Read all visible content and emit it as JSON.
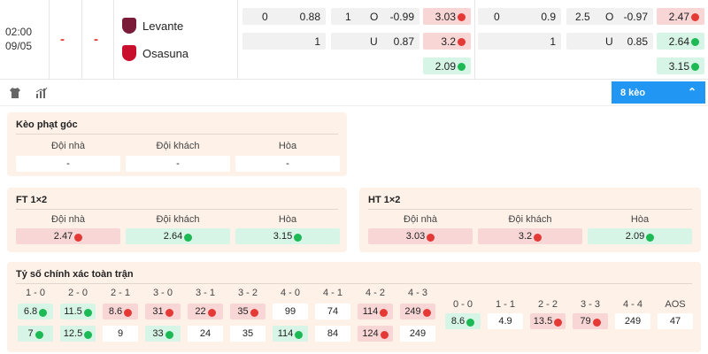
{
  "match": {
    "time": "02:00",
    "date": "09/05",
    "score_home": "-",
    "score_away": "-",
    "home": "Levante",
    "away": "Osasuna",
    "home_color": "#7a1b3a",
    "away_color": "#c8102e"
  },
  "odds": {
    "ft_hcp_home_line": "0",
    "ft_hcp_home_odd": "0.88",
    "ft_hcp_away_odd": "1",
    "ft_ou_line": "1",
    "ft_ou_o": "O",
    "ft_ou_o_odd": "-0.99",
    "ft_ou_u": "U",
    "ft_ou_u_odd": "0.87",
    "ft_1x2_h": "3.03",
    "ft_1x2_a": "3.2",
    "ft_1x2_d": "2.09",
    "ht_hcp_home_line": "0",
    "ht_hcp_home_odd": "0.9",
    "ht_hcp_away_odd": "1",
    "ht_ou_line": "2.5",
    "ht_ou_o": "O",
    "ht_ou_o_odd": "-0.97",
    "ht_ou_u": "U",
    "ht_ou_u_odd": "0.85",
    "ht_1x2_h": "2.47",
    "ht_1x2_a": "2.64",
    "ht_1x2_d": "3.15"
  },
  "toolbar": {
    "shirt_icon": "shirt-icon",
    "stats_icon": "stats-icon",
    "keo_label": "8 kèo",
    "chevron": "^"
  },
  "corner": {
    "title": "Kèo phạt góc",
    "h1": "Đội nhà",
    "h2": "Đội khách",
    "h3": "Hòa",
    "v1": "-",
    "v2": "-",
    "v3": "-"
  },
  "ft12": {
    "title": "FT 1×2",
    "h1": "Đội nhà",
    "h2": "Đội khách",
    "h3": "Hòa",
    "v1": "2.47",
    "v2": "2.64",
    "v3": "3.15"
  },
  "ht12": {
    "title": "HT 1×2",
    "h1": "Đội nhà",
    "h2": "Đội khách",
    "h3": "Hòa",
    "v1": "3.03",
    "v2": "3.2",
    "v3": "2.09"
  },
  "cs": {
    "title": "Tỷ số chính xác toàn trận",
    "left_heads": [
      "1 - 0",
      "2 - 0",
      "2 - 1",
      "3 - 0",
      "3 - 1",
      "3 - 2",
      "4 - 0",
      "4 - 1",
      "4 - 2",
      "4 - 3"
    ],
    "left_row1": [
      "6.8",
      "11.5",
      "8.6",
      "31",
      "22",
      "35",
      "99",
      "74",
      "114",
      "249"
    ],
    "left_row2": [
      "7",
      "12.5",
      "9",
      "33",
      "24",
      "35",
      "114",
      "84",
      "124",
      "249"
    ],
    "right_heads": [
      "0 - 0",
      "1 - 1",
      "2 - 2",
      "3 - 3",
      "4 - 4",
      "AOS"
    ],
    "right_row": [
      "8.6",
      "4.9",
      "13.5",
      "79",
      "249",
      "47"
    ]
  }
}
